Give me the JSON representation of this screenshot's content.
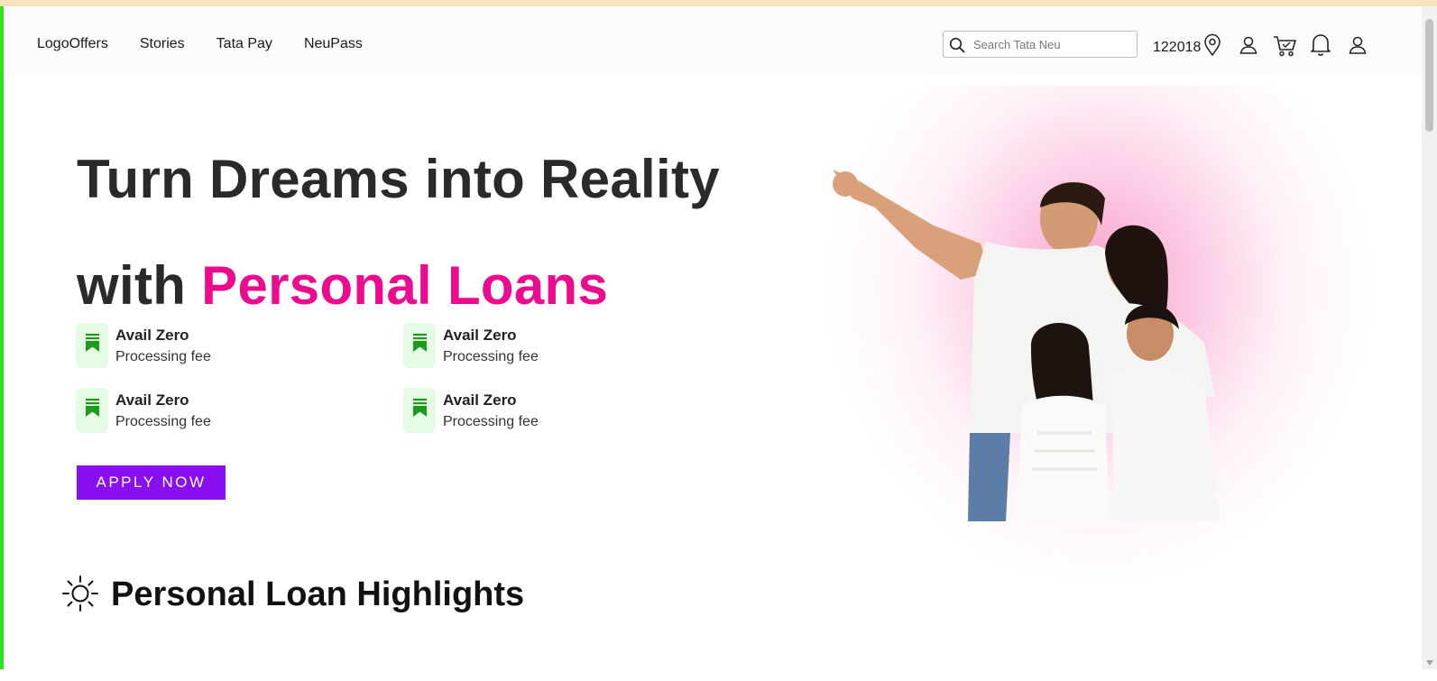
{
  "nav": {
    "links": [
      "LogoOffers",
      "Stories",
      "Tata Pay",
      "NeuPass"
    ],
    "search_placeholder": "Search Tata Neu",
    "pincode": "122018",
    "icons": [
      "location-pin-icon",
      "user-icon",
      "cart-icon",
      "bell-icon",
      "profile-icon"
    ]
  },
  "hero": {
    "title_line1": "Turn Dreams into Reality",
    "title_line2_prefix": "with ",
    "title_line2_accent": "Personal Loans",
    "features": [
      {
        "title": "Avail Zero",
        "subtitle": "Processing fee"
      },
      {
        "title": "Avail Zero",
        "subtitle": "Processing fee"
      },
      {
        "title": "Avail Zero",
        "subtitle": "Processing fee"
      },
      {
        "title": "Avail Zero",
        "subtitle": "Processing fee"
      }
    ],
    "cta_label": "APPLY NOW"
  },
  "highlights": {
    "title": "Personal Loan Highlights"
  },
  "colors": {
    "accent_pink": "#ec0a8e",
    "cta_purple": "#8a0ff0",
    "badge_green": "#1f9a1f"
  }
}
